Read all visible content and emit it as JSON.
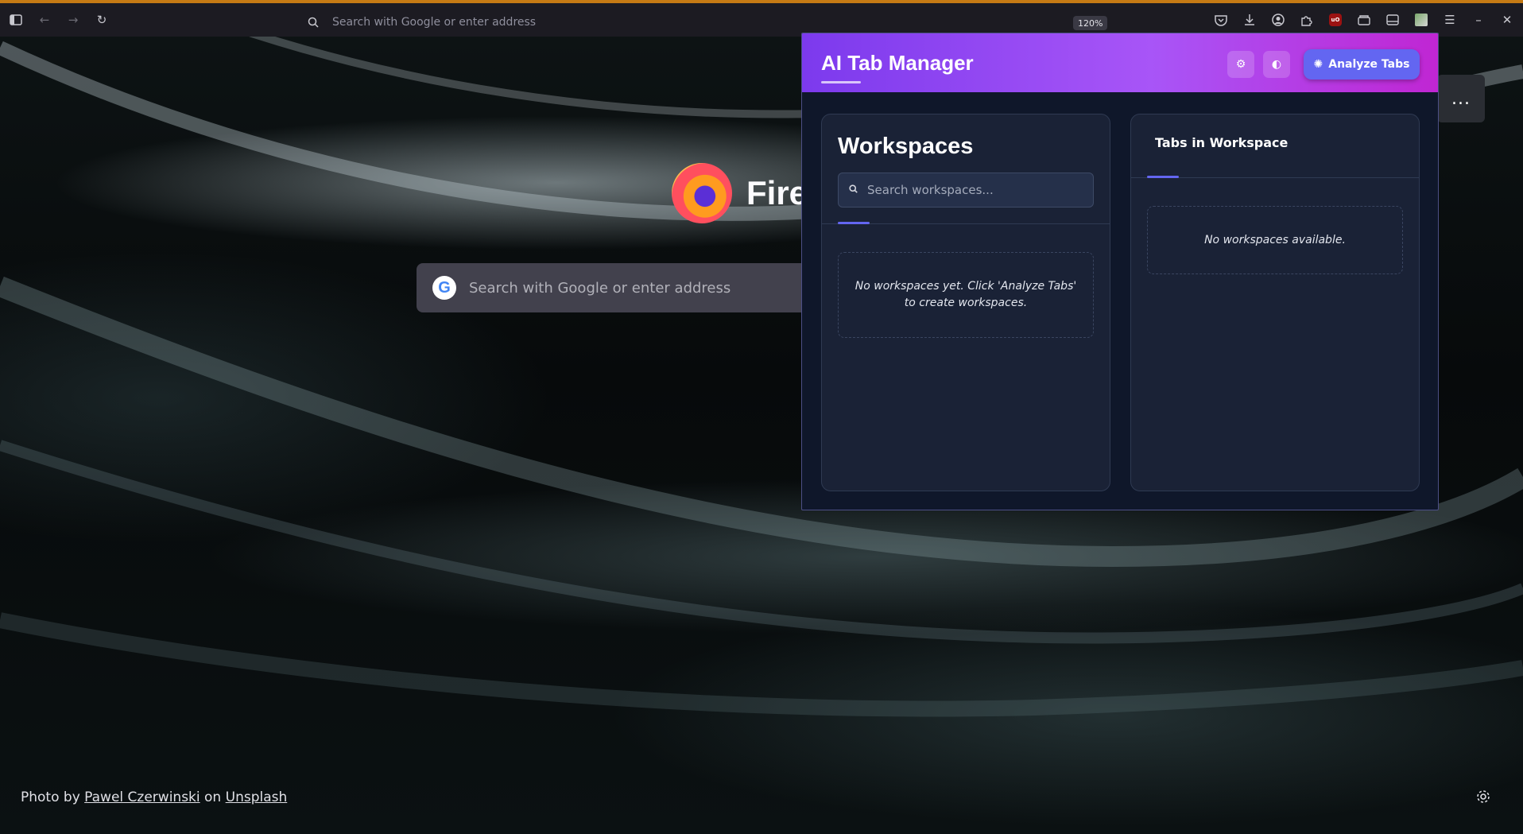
{
  "browser": {
    "urlbar_placeholder": "Search with Google or enter address",
    "zoom": "120%"
  },
  "newtab": {
    "brand": "Fire",
    "search_placeholder": "Search with Google or enter address",
    "credit": {
      "prefix": "Photo by",
      "author": "Pawel Czerwinski",
      "joiner": "on",
      "site": "Unsplash"
    },
    "more_label": "..."
  },
  "popup": {
    "title": "AI Tab Manager",
    "analyze_label": "Analyze Tabs",
    "workspaces": {
      "title": "Workspaces",
      "search_placeholder": "Search workspaces...",
      "empty_text": "No workspaces yet. Click 'Analyze Tabs' to create workspaces."
    },
    "tabs_panel": {
      "title": "Tabs in Workspace",
      "empty_text": "No workspaces available."
    }
  },
  "colors": {
    "accent": "#6366f1",
    "header_gradient_start": "#7c3aed",
    "header_gradient_end": "#c026d3",
    "toolbar": "#1c1b22",
    "popup_bg": "#0f172a"
  }
}
